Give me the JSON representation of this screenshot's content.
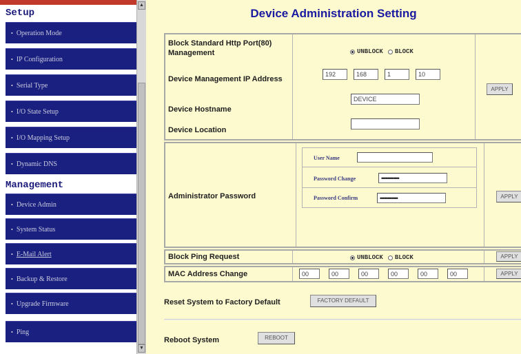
{
  "sidebar": {
    "setup_header": "Setup",
    "management_header": "Management",
    "setup_items": [
      {
        "label": "Operation Mode"
      },
      {
        "label": "IP Configuration"
      },
      {
        "label": "Serial Type"
      },
      {
        "label": "I/O State Setup"
      },
      {
        "label": "I/O Mapping Setup"
      },
      {
        "label": "Dynamic DNS"
      }
    ],
    "management_items": [
      {
        "label": "Device Admin"
      },
      {
        "label": "System Status"
      },
      {
        "label": "E-Mail Alert"
      },
      {
        "label": "Backup & Restore"
      },
      {
        "label": "Upgrade Firmware"
      },
      {
        "label": "Ping"
      }
    ]
  },
  "main": {
    "title": "Device Administration Setting",
    "block_http": {
      "label": "Block Standard Http Port(80) Management",
      "options": [
        "UNBLOCK",
        "BLOCK"
      ],
      "selected": "UNBLOCK"
    },
    "mgmt_ip": {
      "label": "Device Management IP Address",
      "octets": [
        "192",
        "168",
        "1",
        "10"
      ]
    },
    "hostname": {
      "label": "Device Hostname",
      "value": "DEVICE"
    },
    "location": {
      "label": "Device Location",
      "value": ""
    },
    "apply_1": "APPLY",
    "admin_pw": {
      "label": "Administrator Password",
      "user_name_label": "User Name",
      "user_name_value": "",
      "pw_change_label": "Password Change",
      "pw_change_value": "••••••••••••",
      "pw_confirm_label": "Password Confirm",
      "pw_confirm_value": "••••••••••••"
    },
    "apply_2": "APPLY",
    "block_ping": {
      "label": "Block Ping Request",
      "options": [
        "UNBLOCK",
        "BLOCK"
      ],
      "selected": "UNBLOCK"
    },
    "apply_3": "APPLY",
    "mac_change": {
      "label": "MAC Address Change",
      "octets": [
        "00",
        "00",
        "00",
        "00",
        "00",
        "00"
      ]
    },
    "apply_4": "APPLY",
    "reset": {
      "label": "Reset System to Factory Default",
      "button": "FACTORY DEFAULT"
    },
    "reboot": {
      "label": "Reboot System",
      "button": "REBOOT"
    }
  },
  "colors": {
    "sidebar_bg": "#1a2080",
    "main_bg": "#fdfad0",
    "title_color": "#1a1aa0",
    "header_bar": "#c0392b"
  }
}
